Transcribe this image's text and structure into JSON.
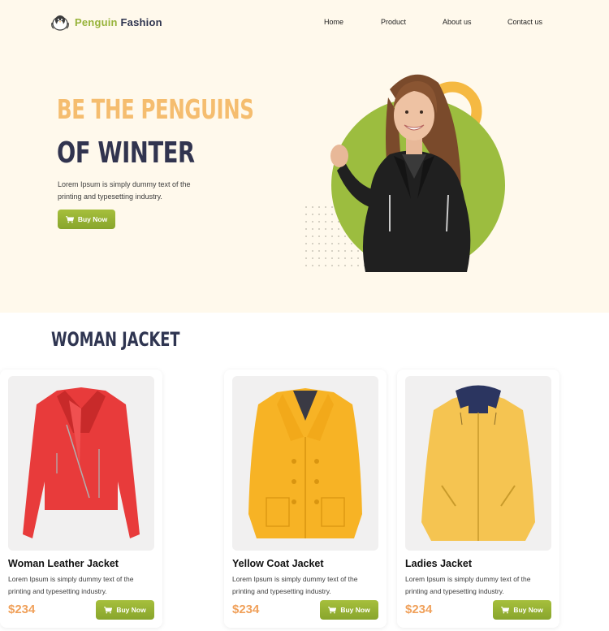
{
  "brand": {
    "name_part1": "Penguin",
    "name_part2": "Fashion"
  },
  "nav": {
    "items": [
      "Home",
      "Product",
      "About us",
      "Contact us"
    ]
  },
  "hero": {
    "title_line1": "BE THE PENGUINS",
    "title_line2": "OF WINTER",
    "description": "Lorem Ipsum is simply dummy text of the printing and typesetting industry.",
    "button_label": "Buy Now"
  },
  "products_section": {
    "title": "WOMAN JACKET",
    "products": [
      {
        "name": "Yellow Coat Jacket",
        "description": "Lorem Ipsum is simply dummy text of the printing and typesetting industry.",
        "price": "$234",
        "button_label": "Buy Now",
        "image_icon": "yellow-coat-image"
      },
      {
        "name": "Ladies Jacket",
        "description": "Lorem Ipsum is simply dummy text of the printing and typesetting industry.",
        "price": "$234",
        "button_label": "Buy Now",
        "image_icon": "yellow-hooded-jacket-image"
      },
      {
        "name": "Woman Leather Jacket",
        "description": "Lorem Ipsum is simply dummy text of the printing and typesetting industry.",
        "price": "$234",
        "button_label": "Buy Now",
        "image_icon": "red-leather-jacket-image"
      }
    ]
  },
  "colors": {
    "accent_green": "#97b33a",
    "accent_orange": "#f5bd6f",
    "navy": "#31344f",
    "price_orange": "#f0a15b",
    "hero_background": "#fff9ec"
  },
  "icons": [
    "penguin-logo-icon",
    "cart-icon"
  ]
}
